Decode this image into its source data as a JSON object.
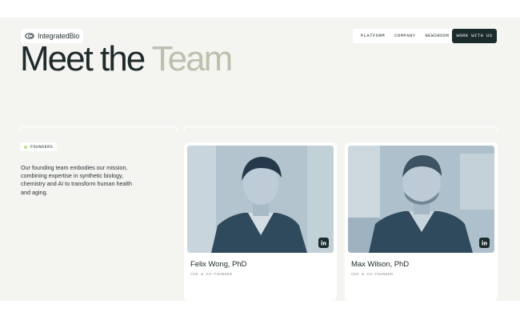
{
  "header": {
    "logo_text": "IntegratedBio",
    "nav": [
      "PLATFORM",
      "COMPANY",
      "NEWSROOM"
    ],
    "cta_label": "WORK WITH US"
  },
  "hero": {
    "title_word1": "Meet the",
    "title_word2": "Team"
  },
  "section": {
    "badge": "FOUNDERS",
    "intro": "Our founding team embodies our mission, combining expertise in synthetic biology, chemistry and AI to transform human health and aging."
  },
  "team": [
    {
      "name": "Felix Wong, PhD",
      "role": "CSO & CO-FOUNDER",
      "linkedin_icon": "linkedin-icon"
    },
    {
      "name": "Max Wilson, PhD",
      "role": "CEO & CO-FOUNDER",
      "linkedin_icon": "linkedin-icon"
    }
  ],
  "colors": {
    "background": "#f4f4f1",
    "dark": "#1c2b2b",
    "muted_title": "#bcbfae",
    "accent_dot": "#b7e08b",
    "photo_tint": "#9fb4c3"
  }
}
